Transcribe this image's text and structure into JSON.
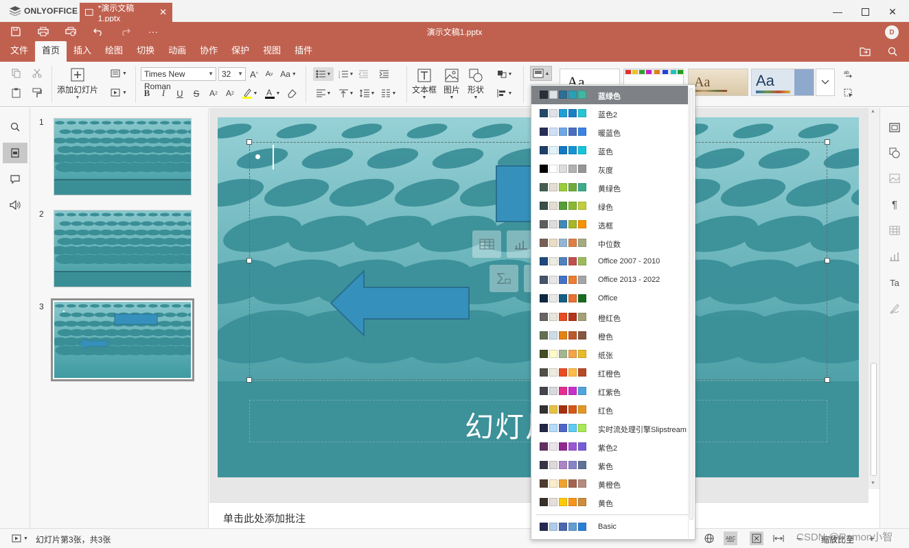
{
  "app": {
    "brand": "ONLYOFFICE",
    "doc_tab": "*演示文稿1.pptx",
    "file_title": "演示文稿1.pptx",
    "avatar": "D"
  },
  "menu_tabs": [
    "文件",
    "首页",
    "插入",
    "绘图",
    "切换",
    "动画",
    "协作",
    "保护",
    "视图",
    "插件"
  ],
  "active_tab": "首页",
  "toolbar": {
    "add_slide": "添加幻灯片",
    "font_name": "Times New Roman",
    "font_size": "32",
    "text_box": "文本框",
    "picture": "图片",
    "shape": "形状",
    "theme_sample": "Aa"
  },
  "thumbnails": [
    "1",
    "2",
    "3"
  ],
  "slide": {
    "title_text": "幻灯片"
  },
  "notes_placeholder": "单击此处添加批注",
  "status": {
    "slide_info": "幻灯片第3张，共3张",
    "zoom_label": "缩放比至",
    "watermark": "CSDN @Ramon小智"
  },
  "colors": {
    "accent": "#c0614f",
    "teal": "#3a9aa2",
    "shape_blue": "#3591bb"
  },
  "color_schemes": [
    {
      "name": "蓝绿色",
      "colors": [
        "#2a2f3a",
        "#dfe3e8",
        "#2e6f94",
        "#2aa0b8",
        "#3fb8a0"
      ],
      "selected": true
    },
    {
      "name": "蓝色2",
      "colors": [
        "#24496a",
        "#dde3e8",
        "#1f9fd5",
        "#1c7fc5",
        "#25c5d5"
      ]
    },
    {
      "name": "暖蓝色",
      "colors": [
        "#272e58",
        "#d0e1f7",
        "#6fa8e8",
        "#4a6ec0",
        "#3b84e4"
      ]
    },
    {
      "name": "蓝色",
      "colors": [
        "#1f3f6b",
        "#dff3fb",
        "#1478c4",
        "#1594d4",
        "#16c5dc"
      ]
    },
    {
      "name": "灰度",
      "colors": [
        "#000000",
        "#ffffff",
        "#dddddd",
        "#b2b2b2",
        "#969696"
      ]
    },
    {
      "name": "黄绿色",
      "colors": [
        "#455f51",
        "#e3ded1",
        "#9acd3b",
        "#6eab3c",
        "#3dab8c"
      ]
    },
    {
      "name": "绿色",
      "colors": [
        "#3a4f4a",
        "#e4ded2",
        "#549e39",
        "#8ab833",
        "#c0cf3a"
      ]
    },
    {
      "name": "选框",
      "colors": [
        "#5e5e5e",
        "#dddddd",
        "#418ab3",
        "#a6b727",
        "#f69200"
      ]
    },
    {
      "name": "中位数",
      "colors": [
        "#775f55",
        "#ebddc3",
        "#94b6d2",
        "#dd8047",
        "#a5ab81"
      ]
    },
    {
      "name": "Office 2007 - 2010",
      "colors": [
        "#1f497d",
        "#eeece1",
        "#4f81bd",
        "#c0504d",
        "#9bbb59"
      ]
    },
    {
      "name": "Office 2013 - 2022",
      "colors": [
        "#44546a",
        "#e7e6e6",
        "#4472c4",
        "#ed7d31",
        "#a5a5a5"
      ]
    },
    {
      "name": "Office",
      "colors": [
        "#0e2841",
        "#e8e8e8",
        "#156082",
        "#e97132",
        "#196b24"
      ]
    },
    {
      "name": "橙红色",
      "colors": [
        "#696464",
        "#e9e5dc",
        "#e84c22",
        "#b1361d",
        "#a5a177"
      ]
    },
    {
      "name": "橙色",
      "colors": [
        "#637052",
        "#ccddea",
        "#e48312",
        "#bd582c",
        "#865640"
      ]
    },
    {
      "name": "纸张",
      "colors": [
        "#444d26",
        "#fefac9",
        "#a5b592",
        "#f3a447",
        "#e7bc29"
      ]
    },
    {
      "name": "红橙色",
      "colors": [
        "#505046",
        "#eeece1",
        "#e84c22",
        "#ffbd47",
        "#b64926"
      ]
    },
    {
      "name": "红紫色",
      "colors": [
        "#454551",
        "#d8d9dc",
        "#e32d91",
        "#c830cc",
        "#4ea6dc"
      ]
    },
    {
      "name": "红色",
      "colors": [
        "#323232",
        "#e5c243",
        "#a5300f",
        "#d55816",
        "#e19825"
      ]
    },
    {
      "name": "实时流处理引擎Slipstream",
      "colors": [
        "#212745",
        "#b4dcfa",
        "#4e67c8",
        "#5eccf3",
        "#a7ea52"
      ]
    },
    {
      "name": "紫色2",
      "colors": [
        "#632e62",
        "#eae5eb",
        "#92278f",
        "#9b57d3",
        "#755dd9"
      ]
    },
    {
      "name": "紫色",
      "colors": [
        "#373545",
        "#dcd8dc",
        "#ad84c6",
        "#8784c7",
        "#5d739a"
      ]
    },
    {
      "name": "黄橙色",
      "colors": [
        "#4e3b30",
        "#fbeec9",
        "#f0a22e",
        "#a5644e",
        "#b58b80"
      ]
    },
    {
      "name": "黄色",
      "colors": [
        "#39302a",
        "#e5dedb",
        "#ffca08",
        "#f8931d",
        "#ce8d3e"
      ]
    },
    {
      "name": "Basic",
      "colors": [
        "#242852",
        "#acccea",
        "#4a66ac",
        "#629dd1",
        "#297fd5"
      ]
    }
  ]
}
